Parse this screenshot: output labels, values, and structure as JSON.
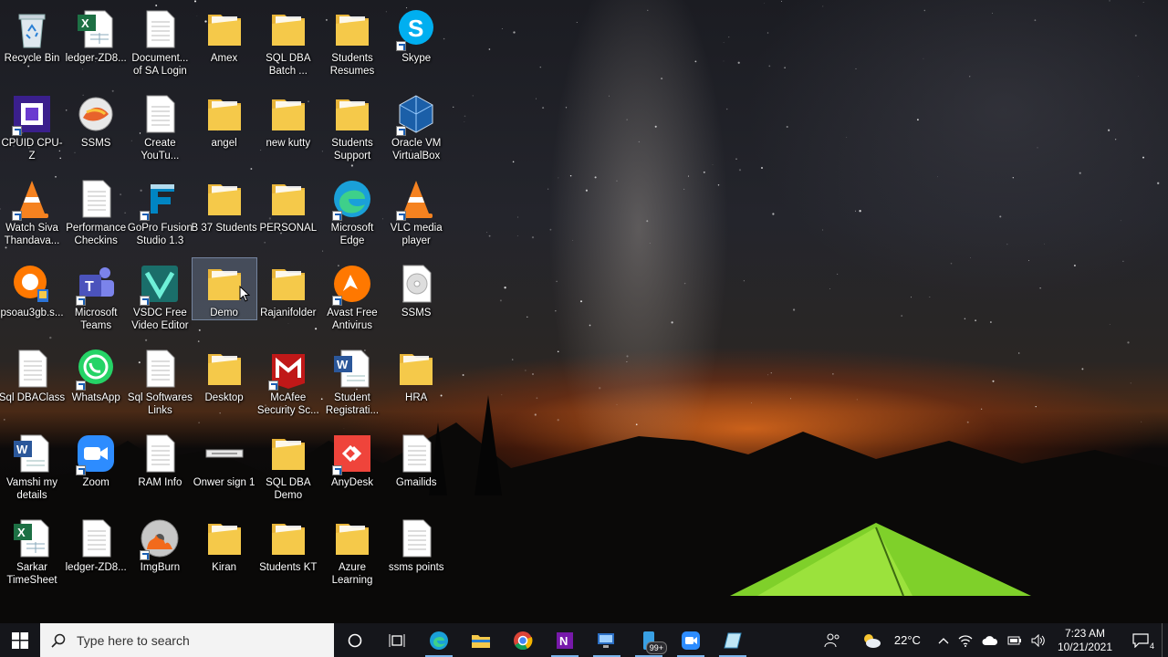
{
  "desktop": {
    "icons": [
      {
        "label": "Recycle Bin",
        "icon": "recycle-bin-icon"
      },
      {
        "label": "ledger-ZD8...",
        "icon": "excel-file-icon"
      },
      {
        "label": "Document... of SA Login",
        "icon": "text-file-icon"
      },
      {
        "label": "Amex",
        "icon": "folder-icon"
      },
      {
        "label": "SQL DBA Batch ...",
        "icon": "folder-icon"
      },
      {
        "label": "Students Resumes",
        "icon": "folder-icon"
      },
      {
        "label": "Skype",
        "icon": "skype-icon"
      },
      {
        "label": "CPUID CPU-Z",
        "icon": "cpuz-icon"
      },
      {
        "label": "SSMS",
        "icon": "ssms-icon"
      },
      {
        "label": "Create YouTu...",
        "icon": "text-file-icon"
      },
      {
        "label": "angel",
        "icon": "folder-icon"
      },
      {
        "label": "new kutty",
        "icon": "folder-icon"
      },
      {
        "label": "Students Support",
        "icon": "folder-icon"
      },
      {
        "label": "Oracle VM VirtualBox",
        "icon": "virtualbox-icon"
      },
      {
        "label": "Watch Siva Thandava...",
        "icon": "vlc-icon"
      },
      {
        "label": "Performance Checkins",
        "icon": "text-file-icon"
      },
      {
        "label": "GoPro Fusion Studio 1.3",
        "icon": "gopro-icon"
      },
      {
        "label": "B 37 Students",
        "icon": "folder-icon"
      },
      {
        "label": "PERSONAL",
        "icon": "folder-icon"
      },
      {
        "label": "Microsoft Edge",
        "icon": "edge-icon"
      },
      {
        "label": "VLC media player",
        "icon": "vlc-icon"
      },
      {
        "label": "psoau3gb.s...",
        "icon": "avast-setup-icon"
      },
      {
        "label": "Microsoft Teams",
        "icon": "teams-icon"
      },
      {
        "label": "VSDC Free Video Editor",
        "icon": "vsdc-icon"
      },
      {
        "label": "Demo",
        "icon": "folder-icon"
      },
      {
        "label": "Rajanifolder",
        "icon": "folder-icon"
      },
      {
        "label": "Avast Free Antivirus",
        "icon": "avast-icon"
      },
      {
        "label": "SSMS",
        "icon": "disc-file-icon"
      },
      {
        "label": "Sql DBAClass",
        "icon": "text-file-icon"
      },
      {
        "label": "WhatsApp",
        "icon": "whatsapp-icon"
      },
      {
        "label": "Sql Softwares Links",
        "icon": "text-file-icon"
      },
      {
        "label": "Desktop",
        "icon": "folder-icon"
      },
      {
        "label": "McAfee Security Sc...",
        "icon": "mcafee-icon"
      },
      {
        "label": "Student Registrati...",
        "icon": "word-file-icon"
      },
      {
        "label": "HRA",
        "icon": "folder-icon"
      },
      {
        "label": "Vamshi my details",
        "icon": "word-file-icon"
      },
      {
        "label": "Zoom",
        "icon": "zoom-icon"
      },
      {
        "label": "RAM Info",
        "icon": "text-file-icon"
      },
      {
        "label": "Onwer sign 1",
        "icon": "image-file-icon"
      },
      {
        "label": "SQL DBA Demo",
        "icon": "folder-icon"
      },
      {
        "label": "AnyDesk",
        "icon": "anydesk-icon"
      },
      {
        "label": "Gmailids",
        "icon": "text-file-icon"
      },
      {
        "label": "Sarkar TimeSheet",
        "icon": "excel-file-icon"
      },
      {
        "label": "ledger-ZD8...",
        "icon": "text-file-icon"
      },
      {
        "label": "ImgBurn",
        "icon": "imgburn-icon"
      },
      {
        "label": "Kiran",
        "icon": "folder-icon"
      },
      {
        "label": "Students KT",
        "icon": "folder-icon"
      },
      {
        "label": "Azure Learning",
        "icon": "folder-icon"
      },
      {
        "label": "ssms points",
        "icon": "text-file-icon"
      }
    ],
    "selected_icon": "Demo"
  },
  "taskbar": {
    "search_placeholder": "Type here to search",
    "pinned": [
      {
        "name": "cortana-icon"
      },
      {
        "name": "task-view-icon"
      },
      {
        "name": "edge-icon"
      },
      {
        "name": "file-explorer-icon"
      },
      {
        "name": "chrome-icon"
      },
      {
        "name": "onenote-icon"
      },
      {
        "name": "remote-desktop-icon"
      },
      {
        "name": "phone-app-icon",
        "badge": "99+"
      },
      {
        "name": "zoom-icon"
      },
      {
        "name": "notepad-icon"
      }
    ],
    "tray": {
      "weather": "22°C",
      "time": "7:23 AM",
      "date": "10/21/2021",
      "notifications": "4"
    }
  },
  "colors": {
    "taskbar_bg": "#15161b",
    "folder_yellow": "#f5c94a",
    "selection": "#96b4dc"
  }
}
